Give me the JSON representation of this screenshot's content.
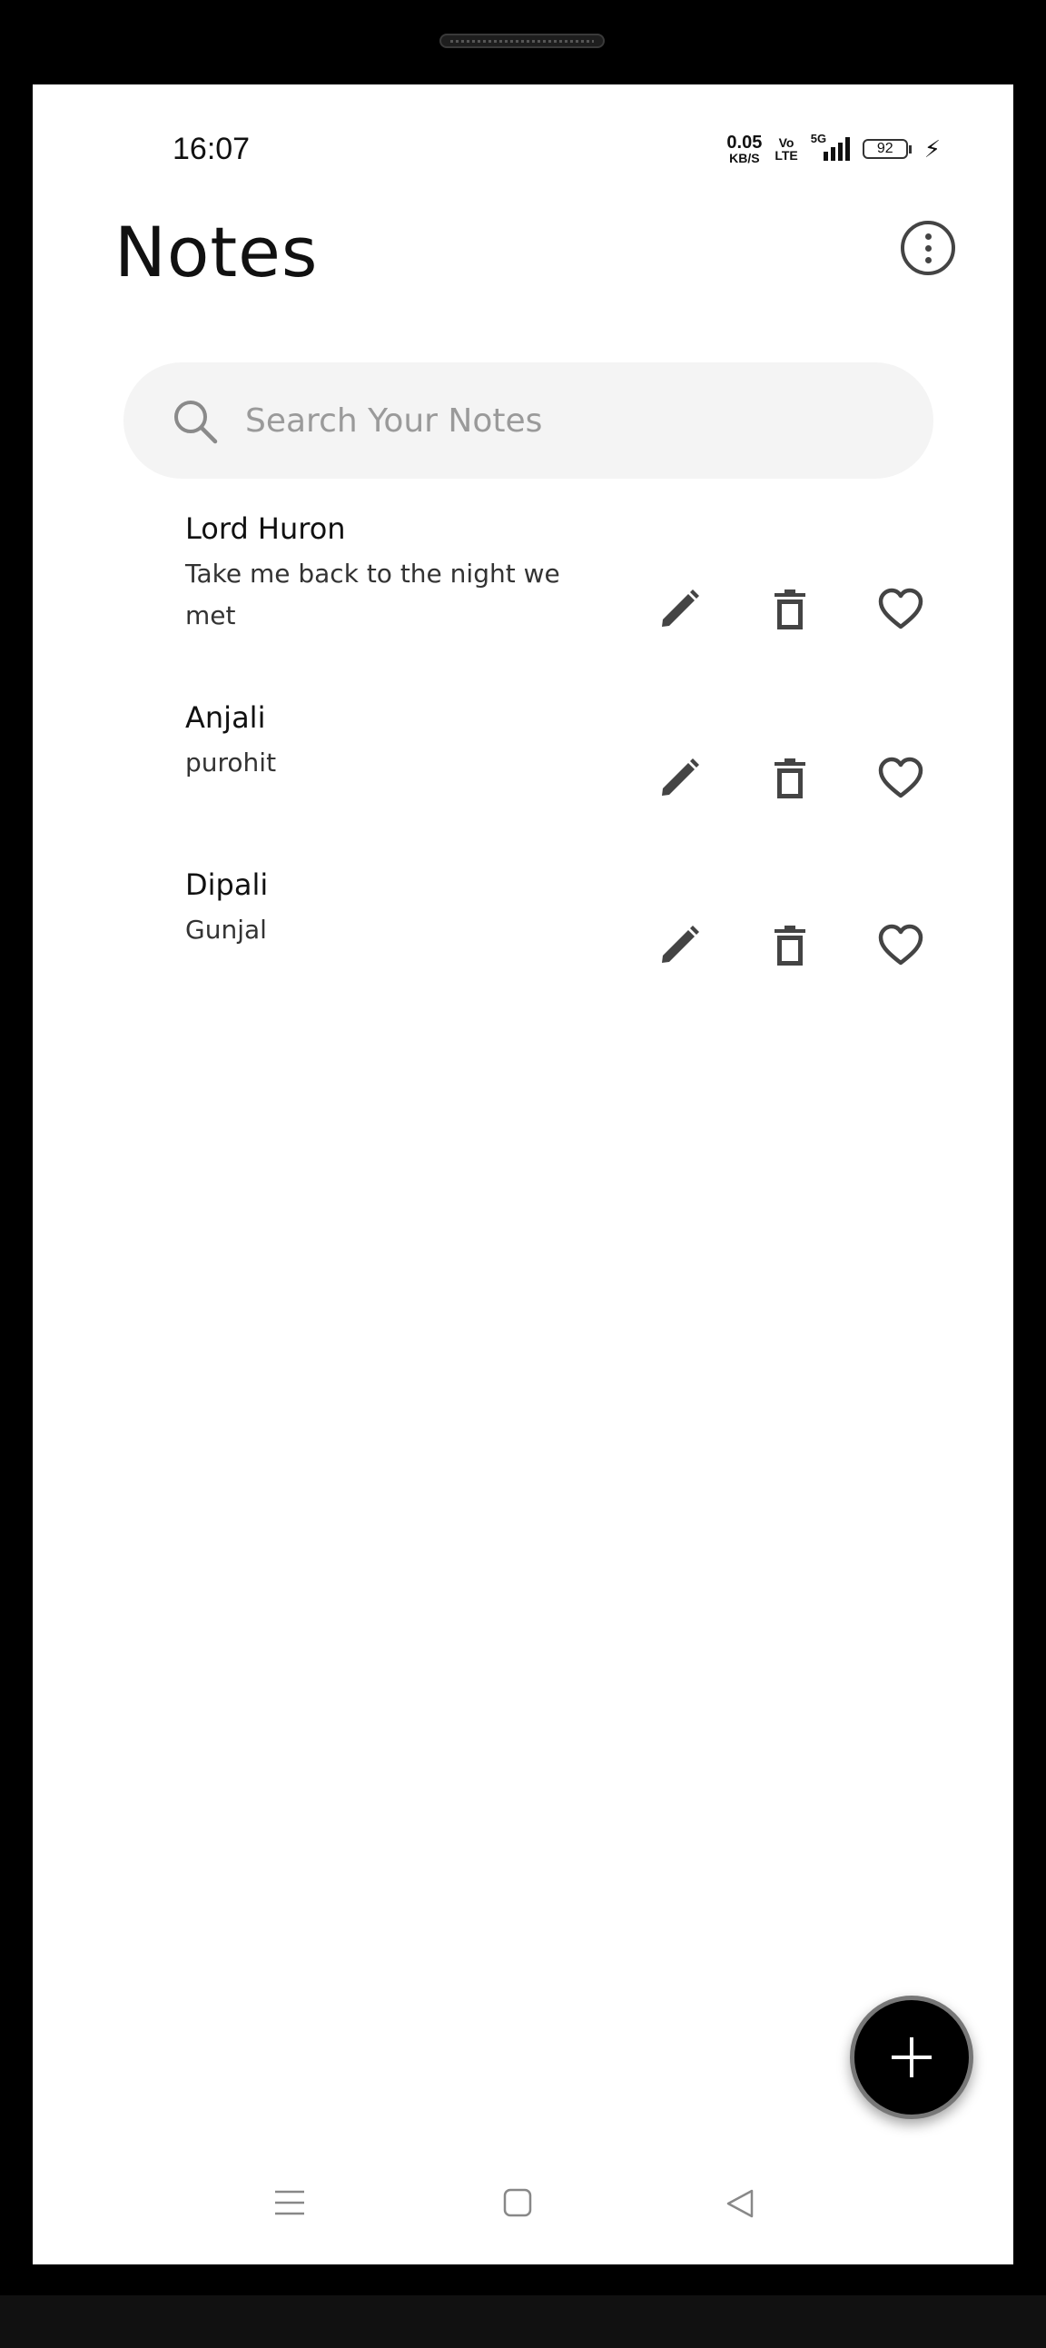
{
  "status_bar": {
    "time": "16:07",
    "net_speed_value": "0.05",
    "net_speed_unit": "KB/S",
    "volte_top": "Vo",
    "volte_bottom": "LTE",
    "network_type": "5G",
    "battery_level": "92",
    "charging_icon": "bolt-icon"
  },
  "header": {
    "title": "Notes",
    "menu_icon": "more-vertical-icon"
  },
  "search": {
    "placeholder": "Search Your Notes",
    "icon": "search-icon"
  },
  "notes": [
    {
      "title": "Lord Huron",
      "body": "Take me back to the night we met"
    },
    {
      "title": "Anjali",
      "body": "purohit"
    },
    {
      "title": "Dipali",
      "body": "Gunjal"
    }
  ],
  "note_actions": {
    "edit_icon": "pencil-icon",
    "delete_icon": "trash-icon",
    "favorite_icon": "heart-outline-icon"
  },
  "fab": {
    "icon": "plus-icon"
  },
  "navigation_bar": {
    "items": [
      "menu-icon",
      "home-icon",
      "back-icon"
    ]
  },
  "colors": {
    "background": "#ffffff",
    "text": "#111111",
    "icon": "#444444",
    "search_background": "#f4f4f4",
    "fab_background": "#000000"
  }
}
